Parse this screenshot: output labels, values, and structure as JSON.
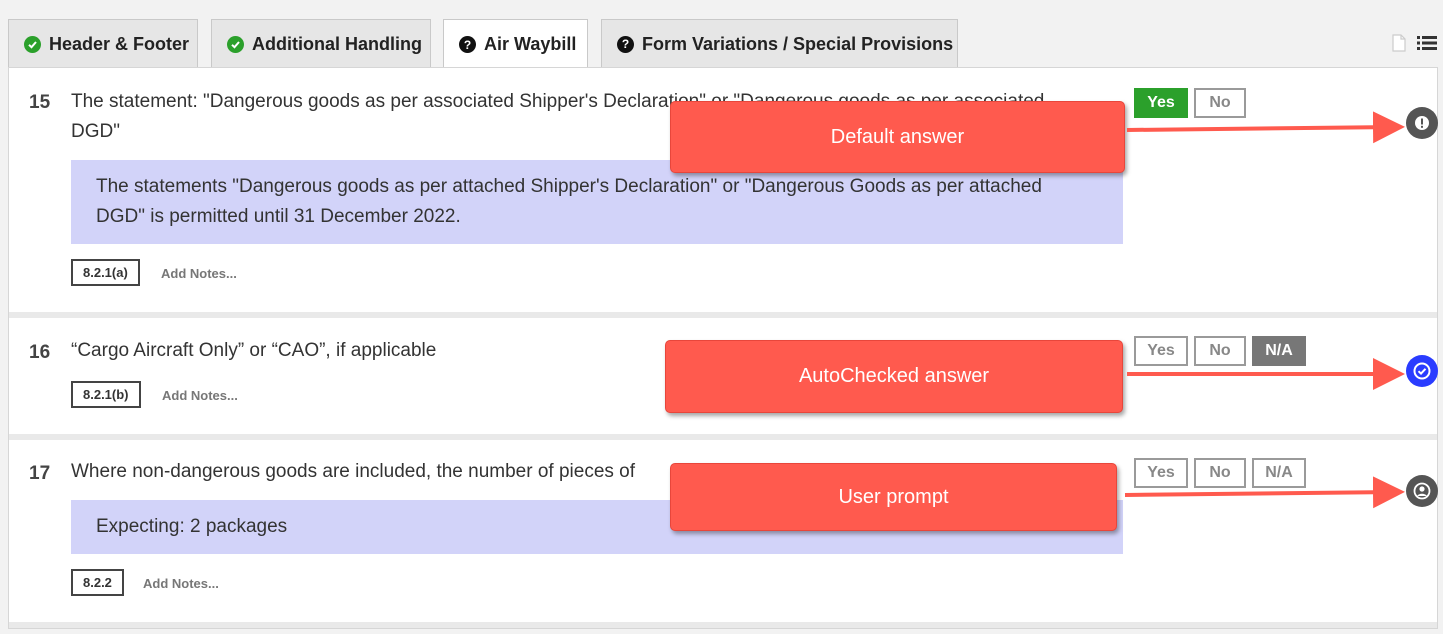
{
  "tabs": [
    {
      "label": "Header & Footer",
      "icon": "check-circle-icon"
    },
    {
      "label": "Additional Handling",
      "icon": "check-circle-icon"
    },
    {
      "label": "Air Waybill",
      "icon": "question-circle-icon",
      "active": true
    },
    {
      "label": "Form Variations / Special Provisions",
      "icon": "question-circle-icon"
    }
  ],
  "questions": [
    {
      "number": "15",
      "text_line1": "The statement: \"Dangerous goods as per associated Shipper's Declaration\" or \"Dangerous goods as per associated",
      "text_line2": "DGD\"",
      "info_line1": "The statements \"Dangerous goods as per attached Shipper's Declaration\" or \"Dangerous Goods as per attached",
      "info_line2": "DGD\" is permitted until 31 December 2022.",
      "reference": "8.2.1(a)",
      "notes": "Add Notes...",
      "yes": "Yes",
      "no": "No",
      "selected": "Yes",
      "status": "default-answer"
    },
    {
      "number": "16",
      "text_line1": "“Cargo Aircraft Only” or “CAO”, if applicable",
      "reference": "8.2.1(b)",
      "notes": "Add Notes...",
      "yes": "Yes",
      "no": "No",
      "na": "N/A",
      "selected": "N/A",
      "status": "auto-checked"
    },
    {
      "number": "17",
      "text_line1": "Where non-dangerous goods are included, the number of pieces of",
      "info_line1": "Expecting: 2 packages",
      "reference": "8.2.2",
      "notes": "Add Notes...",
      "yes": "Yes",
      "no": "No",
      "na": "N/A",
      "selected": "",
      "status": "user-prompt"
    }
  ],
  "callouts": {
    "default": "Default answer",
    "autochecked": "AutoChecked answer",
    "user_prompt": "User prompt"
  },
  "colors": {
    "yes_selected": "#2ba02b",
    "na_selected": "#777777",
    "info_bg": "#d2d3f9",
    "callout": "#ff5a4e",
    "status_default": "#555555",
    "status_autochecked": "#2a3cff",
    "status_user": "#555555"
  }
}
